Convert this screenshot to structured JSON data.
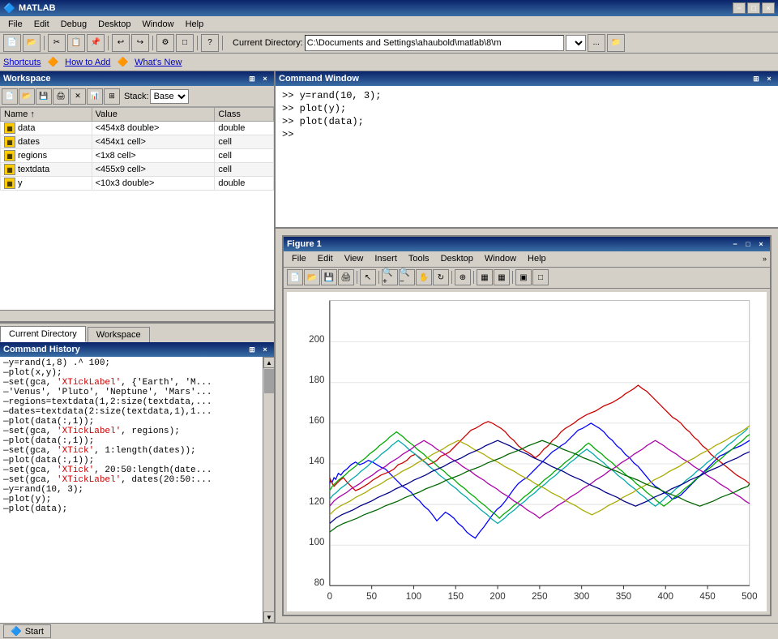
{
  "titlebar": {
    "title": "MATLAB",
    "min": "−",
    "max": "□",
    "close": "×"
  },
  "menubar": {
    "items": [
      "File",
      "Edit",
      "Debug",
      "Desktop",
      "Window",
      "Help"
    ]
  },
  "toolbar": {
    "current_directory_label": "Current Directory:",
    "current_directory_value": "C:\\Documents and Settings\\ahaubold\\matlab\\8\\m",
    "browse_btn": "...",
    "folder_btn": "📁"
  },
  "shortcuts_bar": {
    "items": [
      "Shortcuts",
      "How to Add",
      "What's New"
    ]
  },
  "workspace": {
    "title": "Workspace",
    "stack_label": "Stack:",
    "stack_value": "Base",
    "columns": [
      "Name ↑",
      "Value",
      "Class"
    ],
    "rows": [
      {
        "icon": "grid",
        "name": "data",
        "value": "<454x8 double>",
        "class": "double"
      },
      {
        "icon": "cell",
        "name": "dates",
        "value": "<454x1 cell>",
        "class": "cell"
      },
      {
        "icon": "cell",
        "name": "regions",
        "value": "<1x8 cell>",
        "class": "cell"
      },
      {
        "icon": "cell",
        "name": "textdata",
        "value": "<455x9 cell>",
        "class": "cell"
      },
      {
        "icon": "grid",
        "name": "y",
        "value": "<10x3 double>",
        "class": "double"
      }
    ]
  },
  "tabs": {
    "left": [
      "Current Directory",
      "Workspace"
    ]
  },
  "command_history": {
    "title": "Command History",
    "lines": [
      "y=rand(1,8) .^ 100;",
      "plot(x,y);",
      "set(gca, 'XTickLabel', {'Earth', 'M...",
      "'Venus', 'Pluto', 'Neptune', 'Mars'...",
      "regions=textdata(1,2:size(textdata,...",
      "dates=textdata(2:size(textdata,1),1...",
      "plot(data(:,1));",
      "set(gca, 'XTickLabel', regions);",
      "plot(data(:,1));",
      "set(gca, 'XTick', 1:length(dates));",
      "plot(data(:,1));",
      "set(gca, 'XTick', 20:50:length(date...",
      "set(gca, 'XTickLabel', dates(20:50:...",
      "y=rand(10, 3);",
      "plot(y);",
      "plot(data);"
    ]
  },
  "command_window": {
    "title": "Command Window",
    "lines": [
      ">> y=rand(10, 3);",
      ">> plot(y);",
      ">> plot(data);",
      ">>"
    ]
  },
  "figure": {
    "title": "Figure 1",
    "menu_items": [
      "File",
      "Edit",
      "View",
      "Insert",
      "Tools",
      "Desktop",
      "Window",
      "Help"
    ],
    "y_axis": {
      "max": 200,
      "ticks": [
        80,
        100,
        120,
        140,
        160,
        180,
        200
      ]
    },
    "x_axis": {
      "max": 500,
      "ticks": [
        0,
        50,
        100,
        150,
        200,
        250,
        300,
        350,
        400,
        450,
        500
      ]
    }
  },
  "status_bar": {
    "start_label": "Start"
  }
}
